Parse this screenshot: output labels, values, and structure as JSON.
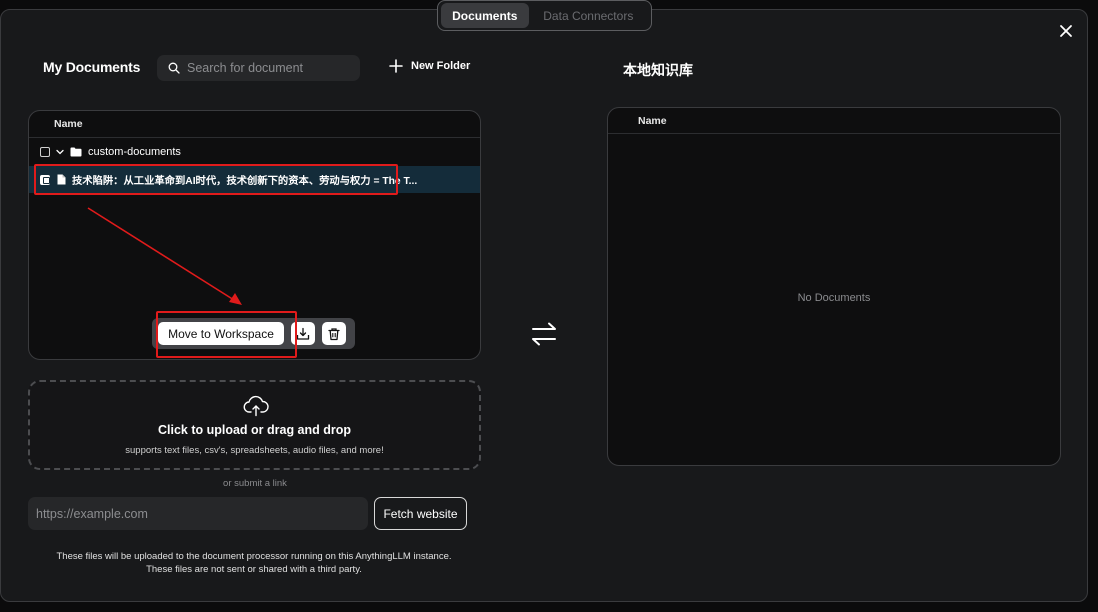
{
  "tabs": [
    {
      "label": "Documents",
      "active": true
    },
    {
      "label": "Data Connectors",
      "active": false
    }
  ],
  "header": {
    "my_documents_title": "My Documents",
    "search_placeholder": "Search for document",
    "new_folder_label": "New Folder",
    "workspace_title": "本地知识库"
  },
  "left_table": {
    "column_name": "Name",
    "folder": {
      "name": "custom-documents",
      "expanded": true,
      "checked": false
    },
    "file": {
      "name": "技术陷阱：从工业革命到AI时代，技术创新下的资本、劳动与权力 = The T...",
      "checked": true
    }
  },
  "actions": {
    "move_label": "Move to Workspace",
    "download_icon": "download-icon",
    "delete_icon": "trash-icon"
  },
  "right_table": {
    "column_name": "Name",
    "empty_text": "No Documents"
  },
  "upload": {
    "title": "Click to upload or drag and drop",
    "subtitle": "supports text files, csv's, spreadsheets, audio files, and more!",
    "or_link": "or submit a link",
    "link_placeholder": "https://example.com",
    "fetch_label": "Fetch website"
  },
  "footer": {
    "line1": "These files will be uploaded to the document processor running on this AnythingLLM instance.",
    "line2": "These files are not sent or shared with a third party."
  },
  "colors": {
    "highlight": "#e01b1b",
    "selected_row": "#142c3a"
  }
}
